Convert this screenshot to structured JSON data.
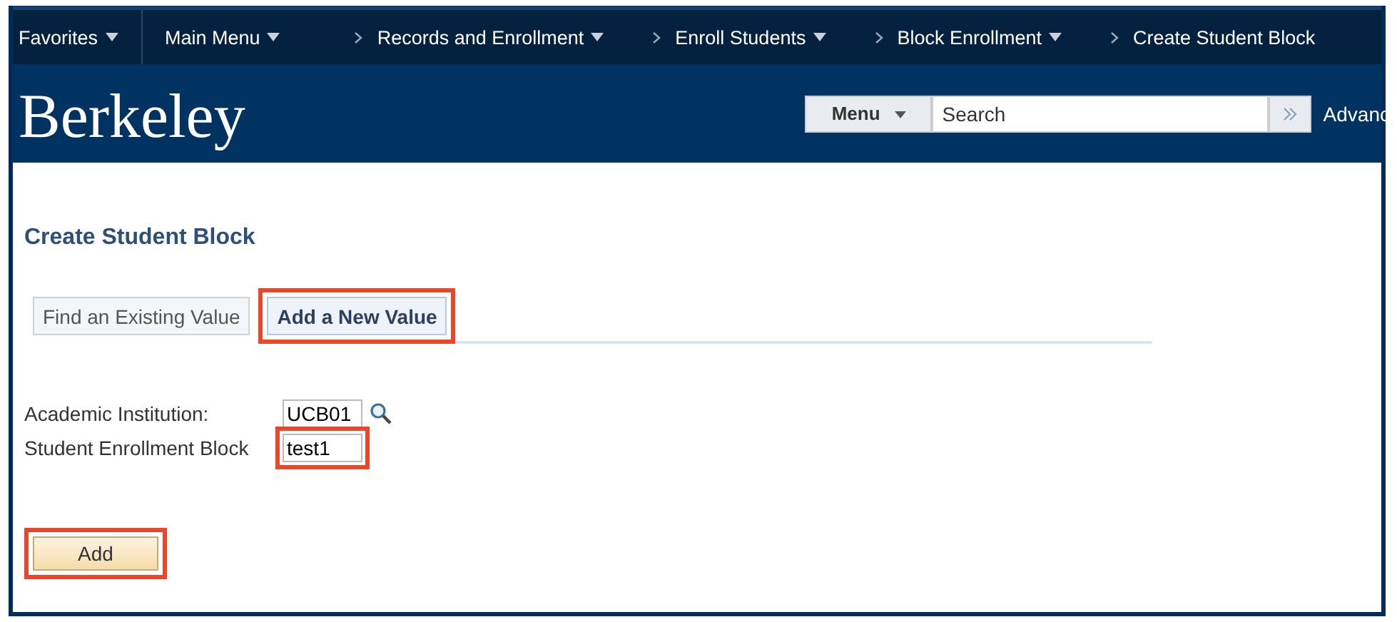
{
  "nav": {
    "favorites": "Favorites",
    "main_menu": "Main Menu",
    "breadcrumbs": [
      {
        "label": "Records and Enrollment",
        "dropdown": true
      },
      {
        "label": "Enroll Students",
        "dropdown": true
      },
      {
        "label": "Block Enrollment",
        "dropdown": true
      },
      {
        "label": "Create Student Block",
        "dropdown": false
      }
    ]
  },
  "header": {
    "logo": "Berkeley",
    "menu_button": "Menu",
    "search": {
      "placeholder": "Search"
    },
    "advanced": "Advanc"
  },
  "page_title": "Create Student Block",
  "tabs": [
    {
      "label": "Find an Existing Value",
      "selected": false,
      "highlighted": false
    },
    {
      "label": "Add a New Value",
      "selected": true,
      "highlighted": true
    }
  ],
  "fields": [
    {
      "label": "Academic Institution:",
      "value": "UCB01",
      "lookup": true,
      "highlighted": false
    },
    {
      "label": "Student Enrollment Block",
      "value": "test1",
      "lookup": false,
      "highlighted": true
    }
  ],
  "add_button": {
    "label": "Add",
    "highlighted": true
  }
}
